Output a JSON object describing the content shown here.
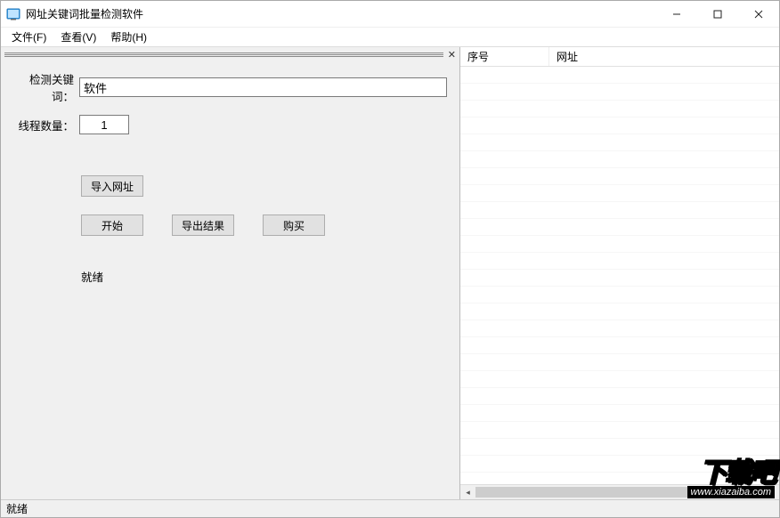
{
  "window": {
    "title": "网址关键词批量检测软件"
  },
  "menu": {
    "file": "文件(F)",
    "view": "查看(V)",
    "help": "帮助(H)"
  },
  "form": {
    "keyword_label": "检测关键词：",
    "keyword_value": "软件",
    "threads_label": "线程数量：",
    "threads_value": "1"
  },
  "buttons": {
    "import_url": "导入网址",
    "start": "开始",
    "export_result": "导出结果",
    "buy": "购买"
  },
  "status_inline": "就绪",
  "table": {
    "col_seq": "序号",
    "col_url": "网址"
  },
  "statusbar": "就绪",
  "brand": {
    "cn": "下载吧",
    "url": "www.xiazaiba.com"
  }
}
